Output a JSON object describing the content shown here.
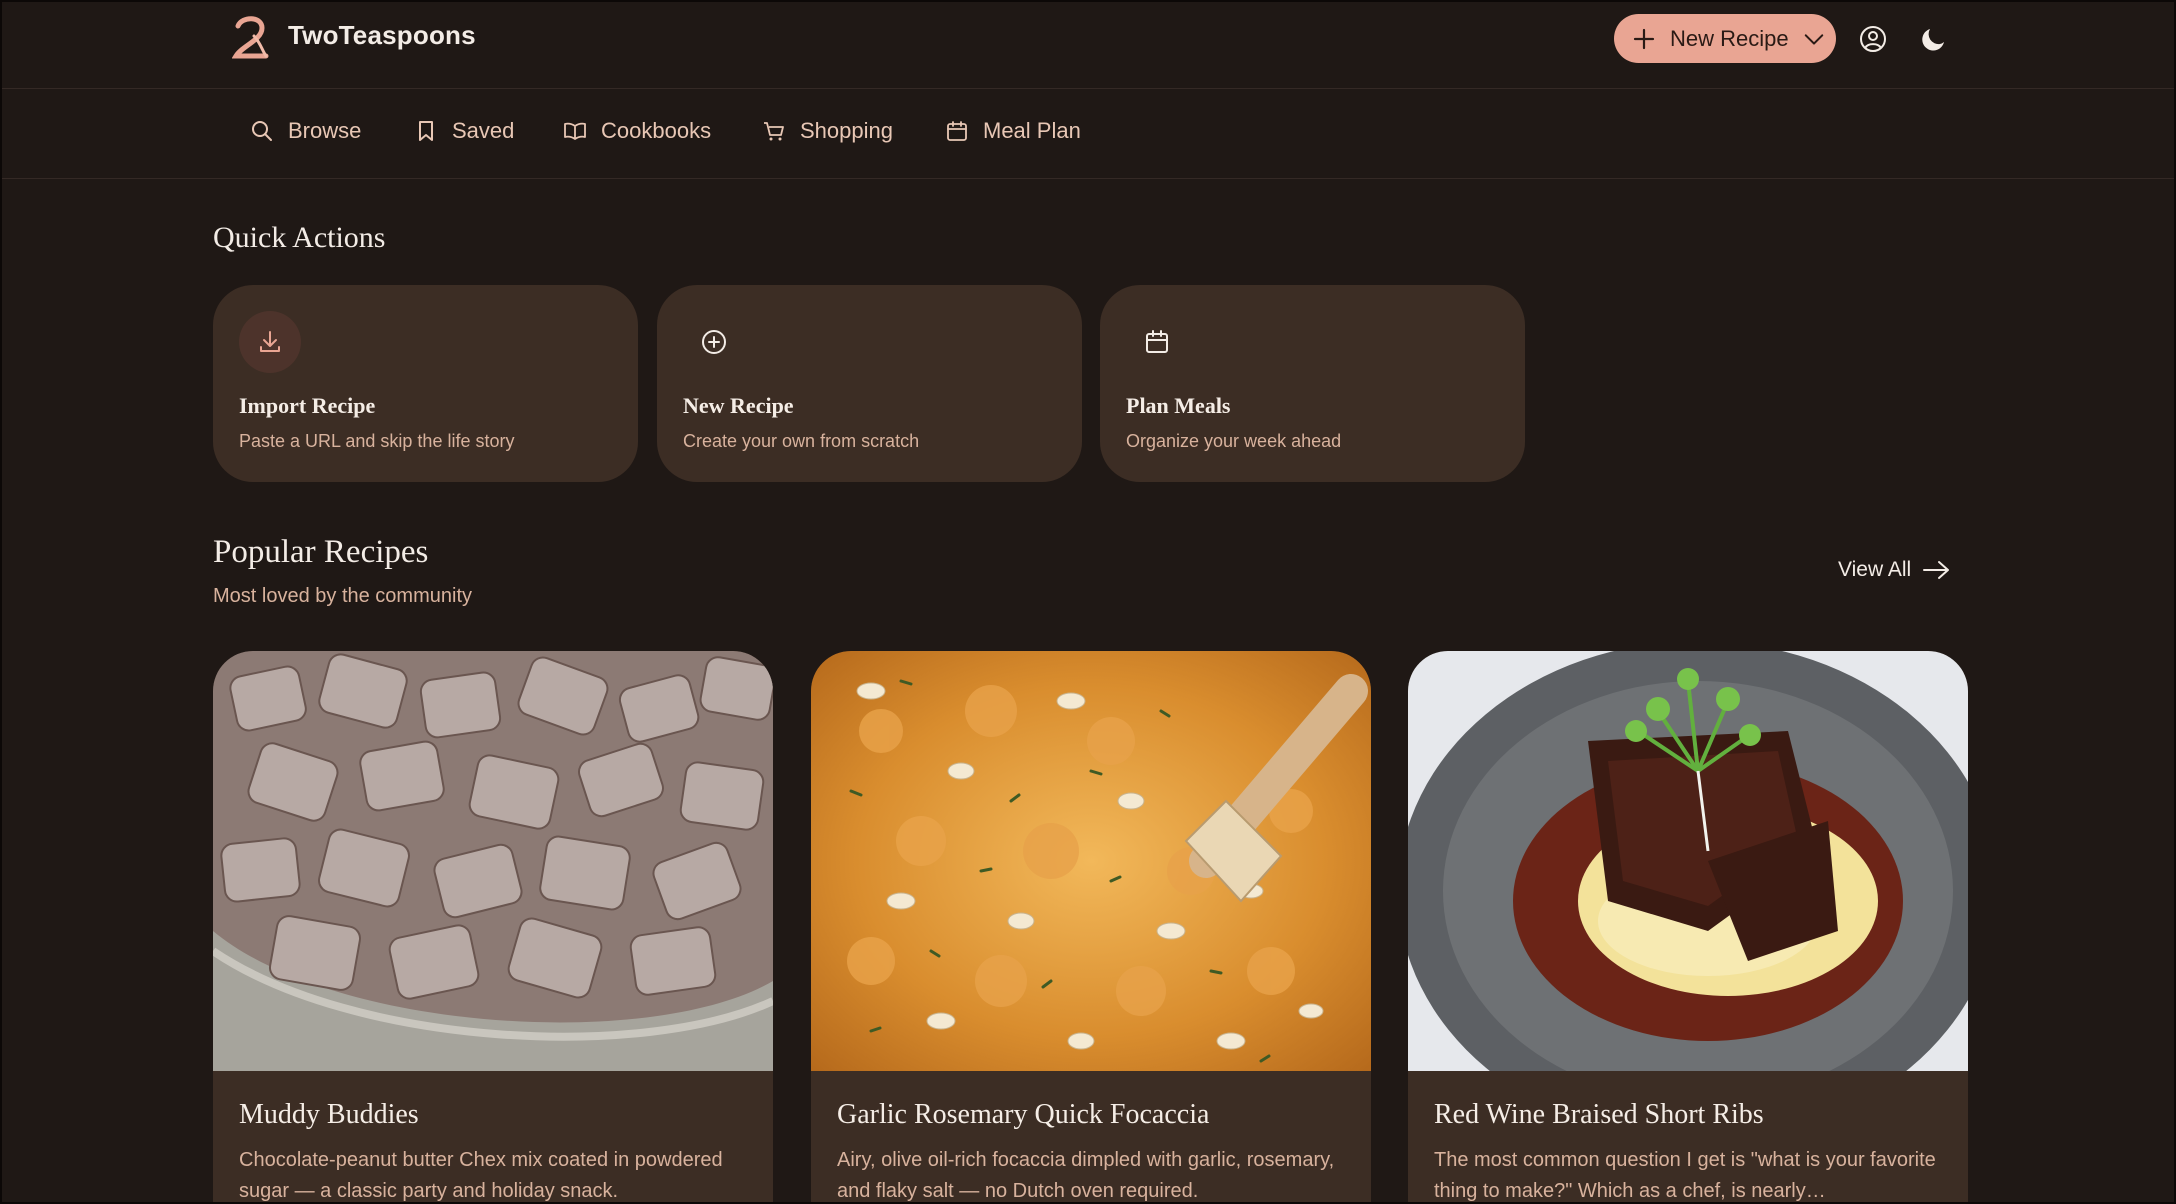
{
  "brand": {
    "name": "TwoTeaspoons",
    "logo_glyph": "2",
    "logo_icon": "two-teaspoons-logo"
  },
  "header": {
    "new_recipe_label": "New Recipe",
    "icons": [
      "plus-icon",
      "chevron-down-icon",
      "user-circle-icon",
      "moon-icon"
    ]
  },
  "nav": {
    "items": [
      {
        "label": "Browse",
        "icon": "search-icon"
      },
      {
        "label": "Saved",
        "icon": "bookmark-icon"
      },
      {
        "label": "Cookbooks",
        "icon": "book-open-icon"
      },
      {
        "label": "Shopping",
        "icon": "cart-icon"
      },
      {
        "label": "Meal Plan",
        "icon": "calendar-icon"
      }
    ]
  },
  "quick_actions": {
    "title": "Quick Actions",
    "cards": [
      {
        "title": "Import Recipe",
        "desc": "Paste a URL and skip the life story",
        "icon": "download-icon"
      },
      {
        "title": "New Recipe",
        "desc": "Create your own from scratch",
        "icon": "plus-circle-icon"
      },
      {
        "title": "Plan Meals",
        "desc": "Organize your week ahead",
        "icon": "calendar-icon"
      }
    ]
  },
  "popular": {
    "title": "Popular Recipes",
    "subtitle": "Most loved by the community",
    "view_all": "View All",
    "recipes": [
      {
        "title": "Muddy Buddies",
        "desc": "Chocolate-peanut butter Chex mix coated in powdered sugar — a classic party and holiday snack.",
        "image": "muddy-buddies-photo"
      },
      {
        "title": "Garlic Rosemary Quick Focaccia",
        "desc": "Airy, olive oil-rich focaccia dimpled with garlic, rosemary, and flaky salt — no Dutch oven required.",
        "image": "focaccia-photo"
      },
      {
        "title": "Red Wine Braised Short Ribs",
        "desc": "The most common question I get is \"what is your favorite thing to make?\" Which as a chef, is nearly…",
        "image": "short-ribs-photo"
      }
    ]
  },
  "colors": {
    "background": "#1f1815",
    "card": "#3c2d24",
    "accent": "#e9a593",
    "muted_text": "#d8b29d",
    "nav_text": "#e8c7b5"
  }
}
